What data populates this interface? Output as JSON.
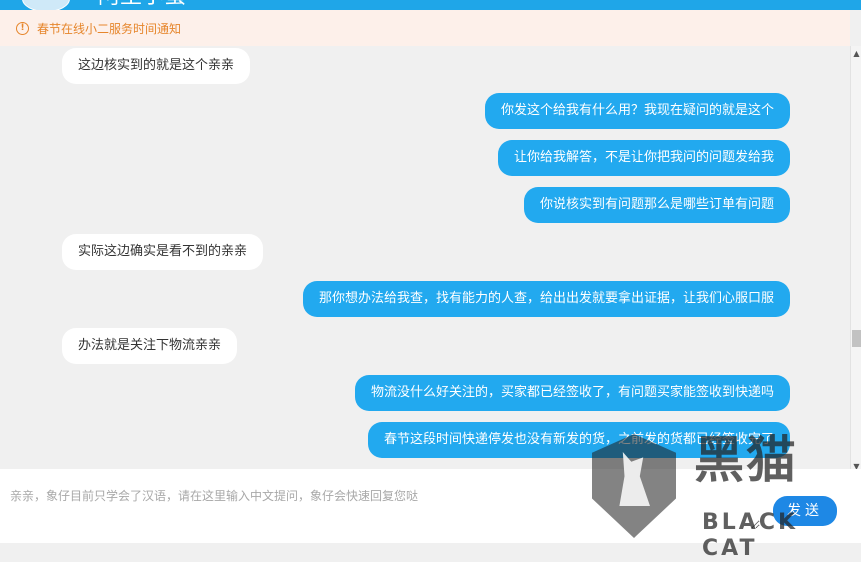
{
  "header": {
    "title_fragment": "阿里小蜜"
  },
  "notice": {
    "icon": "info-circle-icon",
    "text": "春节在线小二服务时间通知"
  },
  "messages": [
    {
      "side": "left",
      "text": "这边核实到的就是这个亲亲"
    },
    {
      "side": "right",
      "text": "你发这个给我有什么用？我现在疑问的就是这个"
    },
    {
      "side": "right",
      "text": "让你给我解答，不是让你把我问的问题发给我"
    },
    {
      "side": "right",
      "text": "你说核实到有问题那么是哪些订单有问题"
    },
    {
      "side": "left",
      "text": "实际这边确实是看不到的亲亲"
    },
    {
      "side": "right",
      "text": "那你想办法给我查，找有能力的人查，给出出发就要拿出证据，让我们心服口服"
    },
    {
      "side": "left",
      "text": "办法就是关注下物流亲亲"
    },
    {
      "side": "right",
      "text": "物流没什么好关注的，买家都已经签收了，有问题买家能签收到快递吗"
    },
    {
      "side": "right",
      "text": "春节这段时间快递停发也没有新发的货，之前发的货都已经签收完了"
    }
  ],
  "input": {
    "placeholder": "亲亲，象仔目前只学会了汉语，请在这里输入中文提问，象仔会快速回复您哒",
    "value": ""
  },
  "send_button": {
    "label": "发送"
  },
  "watermark": {
    "cn": "黑猫",
    "en": "BLACK CAT"
  },
  "colors": {
    "accent": "#1fa6e8",
    "user_bubble": "#22a9ef",
    "agent_bubble": "#ffffff",
    "notice_bg": "#fdf0ea",
    "notice_text": "#e6862c",
    "send_button": "#1e88e5"
  }
}
